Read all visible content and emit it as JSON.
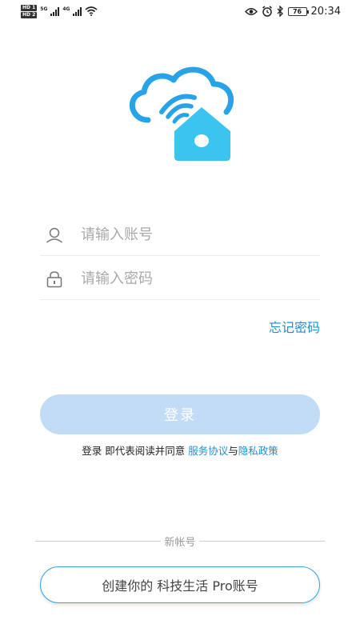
{
  "status_bar": {
    "hd1": "HD 1",
    "hd2": "HD 2",
    "net1": "5G",
    "net2": "4G",
    "battery": "76",
    "time": "20:34",
    "icons": [
      "eye-icon",
      "alarm-icon",
      "bluetooth-icon",
      "wifi-icon"
    ]
  },
  "login": {
    "account_placeholder": "请输入账号",
    "password_placeholder": "请输入密码",
    "forgot": "忘记密码",
    "login_button": "登录",
    "agreement_prefix": "登录 即代表阅读并同意 ",
    "service_link": "服务协议",
    "agreement_and": "与",
    "privacy_link": "隐私政策",
    "new_account_label": "新帐号",
    "create_button": "创建你的 科技生活 Pro账号"
  },
  "colors": {
    "accent": "#1e8fd6",
    "login_button_bg": "#c3dcf6",
    "logo_cloud": "#29a3e8",
    "logo_house": "#3cc4f0"
  }
}
